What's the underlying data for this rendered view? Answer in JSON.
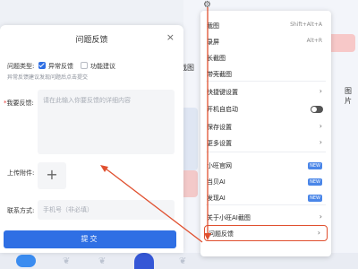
{
  "background": {
    "fragment_text_1": "截图",
    "fragment_text_2": "图片"
  },
  "dialog": {
    "title": "问题反馈",
    "close_label": "×",
    "type_label": "问题类型:",
    "type_option_1": "异常反馈",
    "type_option_2": "功能建议",
    "type_option_1_checked": true,
    "type_option_2_checked": false,
    "hint": "异常反馈建议发现问题后点击提交",
    "feedback_label_required": "*",
    "feedback_label": "我要反馈:",
    "feedback_placeholder": "请在此输入你要反馈的详细内容",
    "upload_label": "上传附件:",
    "upload_plus": "+",
    "contact_label": "联系方式:",
    "contact_placeholder": "手机号（非必填）",
    "submit_label": "提交"
  },
  "menu": {
    "gear_icon": "gear-icon",
    "items": [
      {
        "label": "截图",
        "shortcut": "Shift+Alt+A"
      },
      {
        "label": "录屏",
        "shortcut": "Alt+R"
      },
      {
        "label": "长截图"
      },
      {
        "label": "带壳截图"
      },
      {
        "label": "快捷键设置",
        "chevron": "›"
      },
      {
        "label": "开机自启动",
        "toggle": false
      },
      {
        "label": "保存设置",
        "chevron": "›"
      },
      {
        "label": "更多设置",
        "chevron": "›"
      },
      {
        "label": "小旺官网",
        "tag": "NEW"
      },
      {
        "label": "当贝AI",
        "tag": "NEW"
      },
      {
        "label": "发现AI",
        "tag": "NEW"
      },
      {
        "label": "关于小旺AI截图",
        "chevron": "›"
      },
      {
        "label": "问题反馈",
        "chevron": "›",
        "highlighted": true
      }
    ]
  },
  "colors": {
    "accent": "#2f6fe4",
    "highlight_border": "#e0502f",
    "annotation_arrow": "#e0502f"
  }
}
